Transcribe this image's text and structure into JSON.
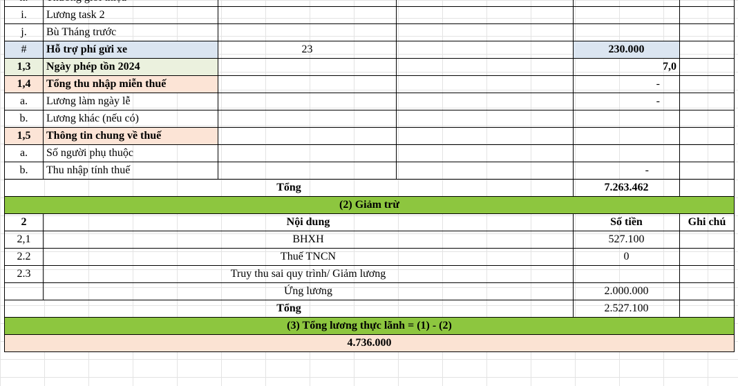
{
  "colors": {
    "blue_row": "#dbe5f1",
    "green_row": "#ebf1de",
    "peach_row": "#fce4d6",
    "section_header": "#8dc63f",
    "grand_total": "#fbe3d3"
  },
  "income_rows": [
    {
      "no": "h.",
      "desc": "Thưởng giới thiệu",
      "qty": "",
      "amount": "",
      "note": ""
    },
    {
      "no": "i.",
      "desc": "Lương task 2",
      "qty": "",
      "amount": "",
      "note": ""
    },
    {
      "no": "j.",
      "desc": "Bù Tháng trước",
      "qty": "",
      "amount": "",
      "note": ""
    },
    {
      "no": "#",
      "desc": "Hỗ trợ phí gửi xe",
      "qty": "23",
      "amount": "230.000",
      "note": ""
    },
    {
      "no": "1,3",
      "desc": "Ngày phép tồn 2024",
      "qty": "",
      "amount": "7,0",
      "note": ""
    },
    {
      "no": "1,4",
      "desc": "Tổng thu nhập miễn thuế",
      "qty": "",
      "amount": "-",
      "note": ""
    },
    {
      "no": "a.",
      "desc": "Lương làm ngày lễ",
      "qty": "",
      "amount": "-",
      "note": ""
    },
    {
      "no": "b.",
      "desc": "Lương khác (nếu có)",
      "qty": "",
      "amount": "",
      "note": ""
    },
    {
      "no": "1,5",
      "desc": "Thông tin chung về thuế",
      "qty": "",
      "amount": "",
      "note": ""
    },
    {
      "no": "a.",
      "desc": "Số người phụ thuộc",
      "qty": "",
      "amount": "",
      "note": ""
    },
    {
      "no": "b.",
      "desc": "Thu nhập tính thuế",
      "qty": "",
      "amount": "-",
      "note": ""
    }
  ],
  "income_total": {
    "label": "Tổng",
    "amount": "7.263.462"
  },
  "deduction": {
    "title": "(2) Giảm trừ",
    "header": {
      "no": "2",
      "desc": "Nội dung",
      "amount": "Số tiền",
      "note": "Ghi chú"
    },
    "rows": [
      {
        "no": "2,1",
        "desc": "BHXH",
        "amount": "527.100"
      },
      {
        "no": "2.2",
        "desc": "Thuế TNCN",
        "amount": "0"
      },
      {
        "no": "2.3",
        "desc": "Truy thu sai quy trình/ Giảm lương",
        "amount": ""
      },
      {
        "no": "",
        "desc": "Ứng lương",
        "amount": "2.000.000"
      }
    ],
    "total": {
      "label": "Tổng",
      "amount": "2.527.100"
    }
  },
  "net": {
    "title": "(3) Tổng lương thực lãnh =  (1) - (2)",
    "amount": "4.736.000"
  }
}
